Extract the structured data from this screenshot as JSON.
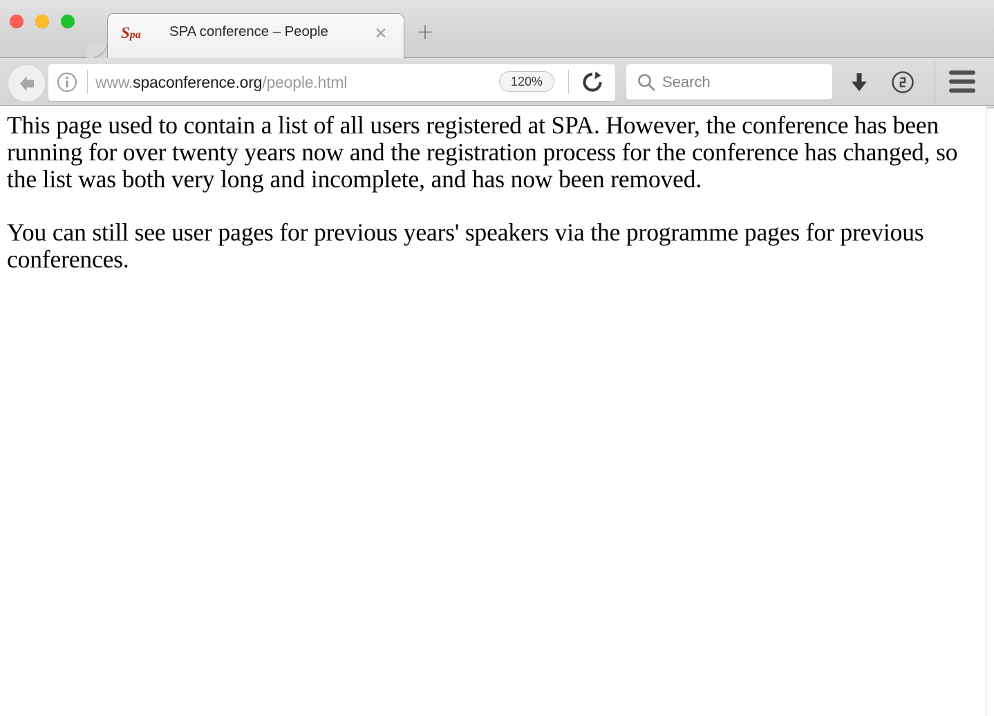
{
  "window": {
    "controls": [
      {
        "name": "close",
        "color": "#fa5e55"
      },
      {
        "name": "minimize",
        "color": "#fcbb28"
      },
      {
        "name": "maximize",
        "color": "#1fc32f"
      }
    ]
  },
  "tabs": {
    "active": {
      "favicon_big": "S",
      "favicon_small": "pa",
      "favicon_color": "#b32d0d",
      "title": "SPA conference – People",
      "close_glyph": "✕"
    },
    "new_tab_glyph": "+"
  },
  "toolbar": {
    "back_label": "Back",
    "identity_icon": "info-icon",
    "url": {
      "scheme_prefix": "www.",
      "host": "spaconference.org",
      "path": "/people.html",
      "full": "www.spaconference.org/people.html"
    },
    "zoom_level": "120%",
    "reload_label": "Reload",
    "search": {
      "placeholder": "Search",
      "value": ""
    },
    "downloads_label": "Downloads",
    "password_manager_label": "1Password",
    "menu_label": "Open menu"
  },
  "page": {
    "paragraphs": [
      "This page used to contain a list of all users registered at SPA. However, the conference has been running for over twenty years now and the registration process for the conference has changed, so the list was both very long and incomplete, and has now been removed.",
      "You can still see user pages for previous years' speakers via the programme pages for previous conferences."
    ]
  }
}
